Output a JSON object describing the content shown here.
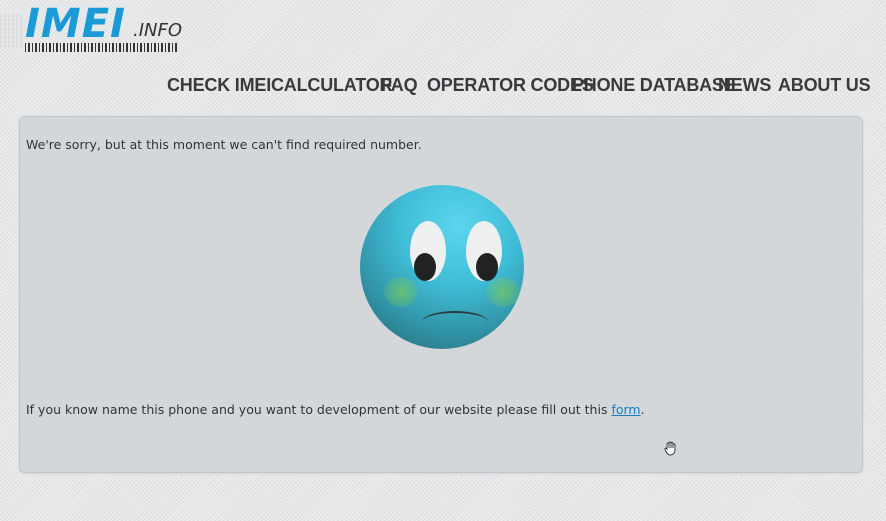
{
  "logo": {
    "main": "IMEI",
    "suffix": ".INFO"
  },
  "nav": {
    "check_imei": "CHECK IMEI",
    "calculator": "CALCULATOR",
    "faq": "FAQ",
    "operator_codes": "OPERATOR CODES",
    "phone_database": "PHONE DATABASE",
    "news": "NEWS",
    "about_us": "ABOUT US"
  },
  "content": {
    "sorry_message": "We're sorry, but at this moment we can't find required number.",
    "help_prefix": "If you know name this phone and you want to development of our website please fill out this ",
    "form_link": "form",
    "help_suffix": "."
  },
  "icons": {
    "face": "sad-face-icon",
    "cursor": "hand-cursor-icon"
  },
  "colors": {
    "logo": "#1a9ad6",
    "link": "#1a7fc4",
    "face": "#3fbcd6"
  }
}
